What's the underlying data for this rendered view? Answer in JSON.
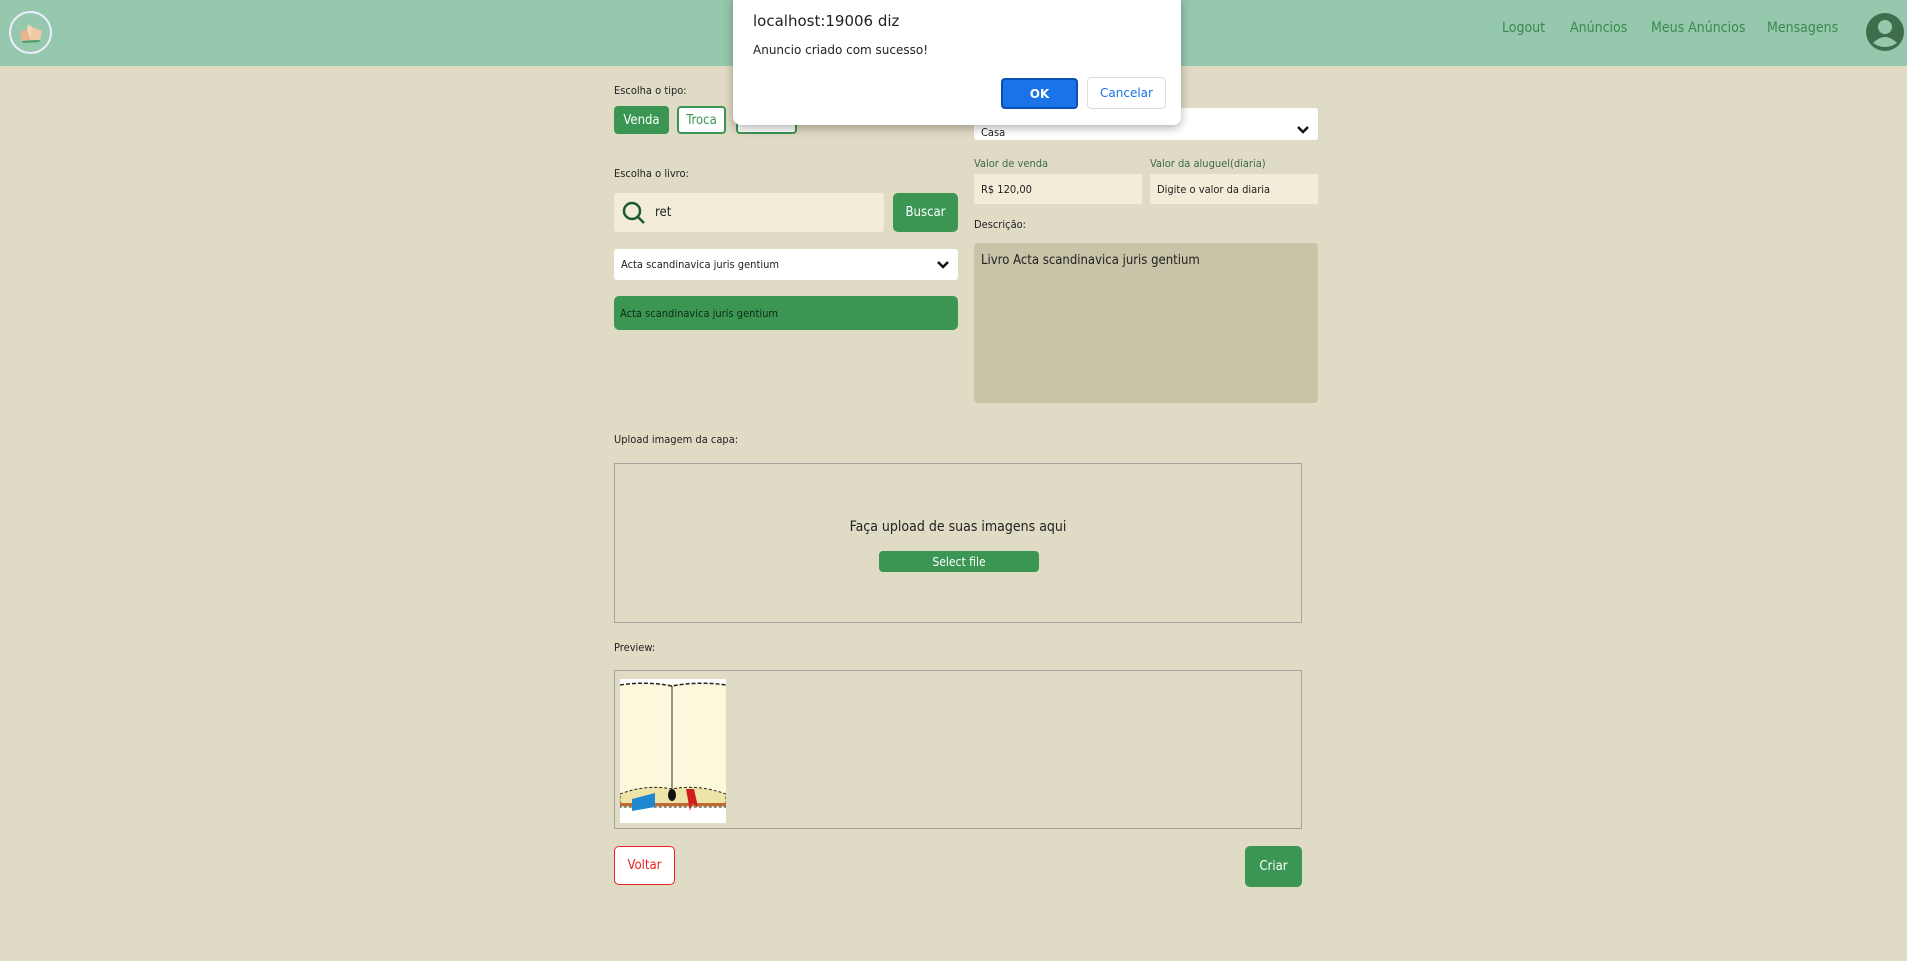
{
  "header": {
    "nav": [
      "Logout",
      "Anúncios",
      "Meus Anúncios",
      "Mensagens"
    ]
  },
  "dialog": {
    "title": "localhost:19006 diz",
    "message": "Anuncio criado com sucesso!",
    "ok": "OK",
    "cancel": "Cancelar"
  },
  "form": {
    "type_label": "Escolha o tipo:",
    "types": [
      "Venda",
      "Troca"
    ],
    "category_value": "Casa",
    "sale_label": "Valor de venda",
    "sale_value": "R$ 120,00",
    "rent_label": "Valor da aluguel(diaria)",
    "rent_placeholder": "Digite o valor da diaria",
    "desc_label": "Descrição:",
    "desc_value": "Livro Acta scandinavica juris gentium",
    "book_label": "Escolha o livro:",
    "search_value": "ret",
    "search_button": "Buscar",
    "book_select": "Acta scandinavica juris gentium",
    "book_result": "Acta scandinavica juris gentium",
    "upload_label": "Upload imagem da capa:",
    "upload_text": "Faça upload de suas imagens aqui",
    "select_file": "Select file",
    "preview_label": "Preview:",
    "back": "Voltar",
    "create": "Criar"
  },
  "colors": {
    "header": "#96c8ae",
    "accent": "#3b9654",
    "bg": "#e0dbc5",
    "dialog_ok": "#1a73e8"
  }
}
